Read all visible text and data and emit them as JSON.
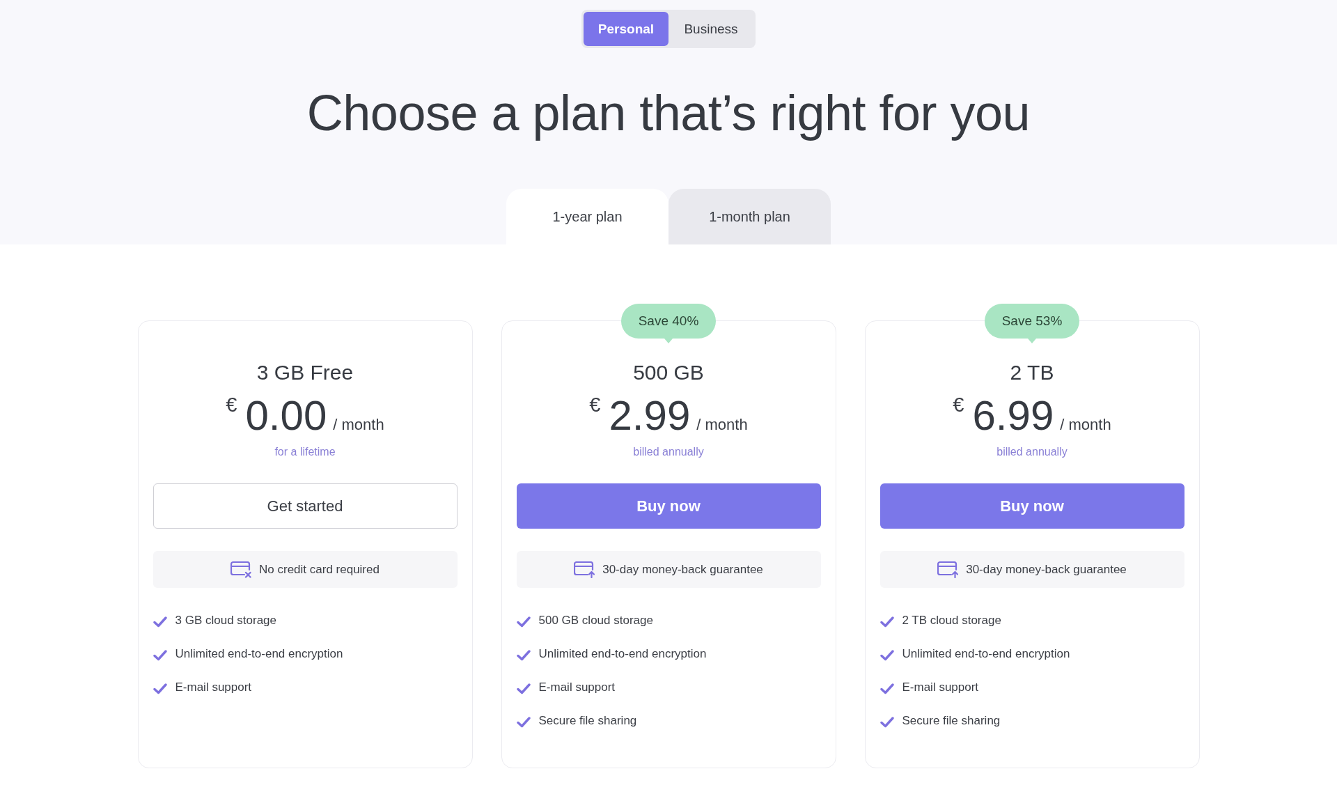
{
  "plan_switch": [
    {
      "label": "Personal",
      "selected": true
    },
    {
      "label": "Business",
      "selected": false
    }
  ],
  "heading": "Choose a plan that’s right for you",
  "billing_tabs": [
    {
      "label": "1-year plan",
      "selected": true
    },
    {
      "label": "1-month plan",
      "selected": false
    }
  ],
  "plans": [
    {
      "name": "3 GB Free",
      "currency": "€",
      "price": "0.00",
      "period": "/ month",
      "note": "for a lifetime",
      "button": {
        "kind": "outline",
        "label": "Get started"
      },
      "info": {
        "kind": "no_card",
        "text": "No credit card required"
      },
      "features": [
        "3 GB cloud storage",
        "Unlimited end-to-end encryption",
        "E-mail support"
      ]
    },
    {
      "badge": "Save 40%",
      "name": "500 GB",
      "currency": "€",
      "price": "2.99",
      "period": "/ month",
      "note": "billed annually",
      "button": {
        "kind": "primary",
        "label": "Buy now"
      },
      "info": {
        "kind": "refund",
        "text": "30-day money-back guarantee"
      },
      "features": [
        "500 GB cloud storage",
        "Unlimited end-to-end encryption",
        "E-mail support",
        "Secure file sharing"
      ]
    },
    {
      "badge": "Save 53%",
      "name": "2 TB",
      "currency": "€",
      "price": "6.99",
      "period": "/ month",
      "note": "billed annually",
      "button": {
        "kind": "primary",
        "label": "Buy now"
      },
      "info": {
        "kind": "refund",
        "text": "30-day money-back guarantee"
      },
      "features": [
        "2 TB cloud storage",
        "Unlimited end-to-end encryption",
        "E-mail support",
        "Secure file sharing"
      ]
    }
  ]
}
